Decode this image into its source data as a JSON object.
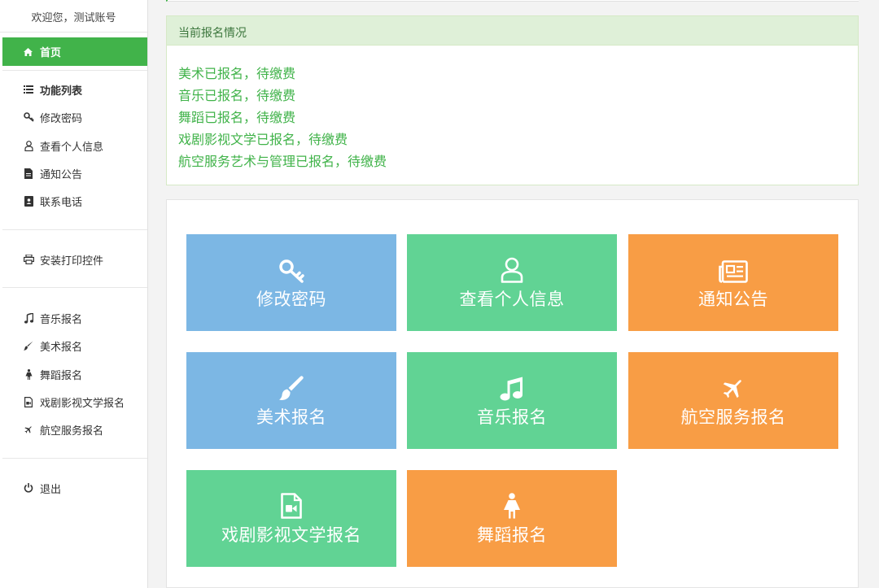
{
  "sidebar": {
    "welcome": "欢迎您，测试账号",
    "home": {
      "label": "首页",
      "icon": "home-icon"
    },
    "function_list": {
      "label": "功能列表",
      "icon": "list-icon"
    },
    "items": [
      {
        "label": "修改密码",
        "icon": "key-icon"
      },
      {
        "label": "查看个人信息",
        "icon": "user-icon"
      },
      {
        "label": "通知公告",
        "icon": "file-icon"
      },
      {
        "label": "联系电话",
        "icon": "phone-book-icon"
      }
    ],
    "print": {
      "label": "安装打印控件",
      "icon": "print-icon"
    },
    "registrations": [
      {
        "label": "音乐报名",
        "icon": "music-icon"
      },
      {
        "label": "美术报名",
        "icon": "brush-icon"
      },
      {
        "label": "舞蹈报名",
        "icon": "female-icon"
      },
      {
        "label": "戏剧影视文学报名",
        "icon": "video-file-icon"
      },
      {
        "label": "航空服务报名",
        "icon": "plane-icon"
      }
    ],
    "logout": {
      "label": "退出",
      "icon": "power-icon"
    }
  },
  "status_panel": {
    "title": "当前报名情况",
    "lines": [
      "美术已报名，待缴费",
      "音乐已报名，待缴费",
      "舞蹈已报名，待缴费",
      "戏剧影视文学已报名，待缴费",
      "航空服务艺术与管理已报名，待缴费"
    ]
  },
  "tiles": [
    {
      "label": "修改密码",
      "icon": "key-icon",
      "color": "#7cb7e4"
    },
    {
      "label": "查看个人信息",
      "icon": "user-icon",
      "color": "#61d394"
    },
    {
      "label": "通知公告",
      "icon": "newspaper-icon",
      "color": "#f89d45"
    },
    {
      "label": "美术报名",
      "icon": "brush-icon",
      "color": "#7cb7e4"
    },
    {
      "label": "音乐报名",
      "icon": "music-icon",
      "color": "#61d394"
    },
    {
      "label": "航空服务报名",
      "icon": "plane-icon",
      "color": "#f89d45"
    },
    {
      "label": "戏剧影视文学报名",
      "icon": "video-file-icon",
      "color": "#61d394"
    },
    {
      "label": "舞蹈报名",
      "icon": "female-icon",
      "color": "#f89d45"
    }
  ],
  "colors": {
    "accent": "#41b34a",
    "status_text": "#41b34a",
    "panel_head_bg": "#dff0d8"
  }
}
